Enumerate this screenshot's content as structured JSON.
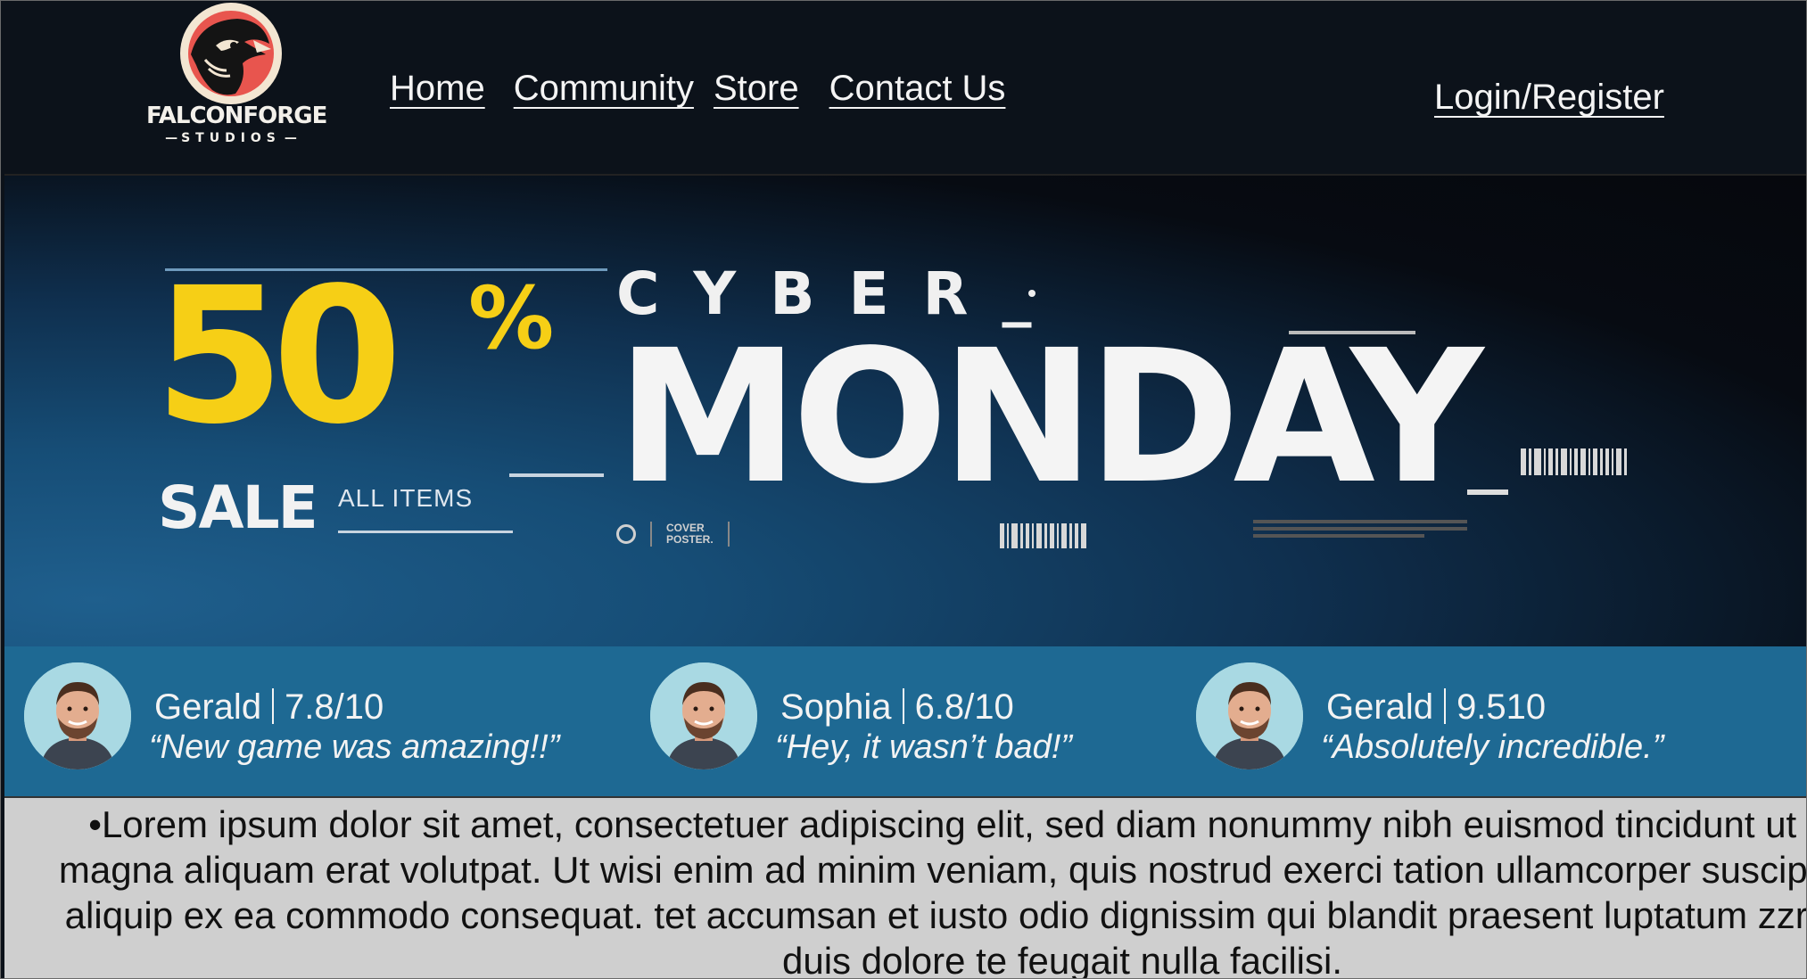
{
  "brand": {
    "name": "FALCONFORGE",
    "subtitle": "STUDIOS"
  },
  "nav": {
    "home": "Home",
    "community": "Community",
    "store": "Store",
    "contact": "Contact Us"
  },
  "auth": {
    "login": "Login/Register"
  },
  "hero": {
    "percent": "50",
    "percent_sign": "%",
    "sale": "SALE",
    "all_items": "ALL ITEMS",
    "cyber": "CYBER_",
    "monday": "MONDAY",
    "badge_line1": "COVER",
    "badge_line2": "POSTER."
  },
  "reviews": [
    {
      "name": "Gerald",
      "score": "7.8/10",
      "quote": "“New game was amazing!!”"
    },
    {
      "name": "Sophia",
      "score": "6.8/10",
      "quote": "“Hey, it wasn’t bad!”"
    },
    {
      "name": "Gerald",
      "score": "9.510",
      "quote": "“Absolutely incredible.”"
    }
  ],
  "body": {
    "bullet": "•",
    "text": "Lorem ipsum dolor sit amet, consectetuer adipiscing elit, sed diam nonummy nibh euismod tincidunt ut laoreet dolore magna aliquam erat volutpat. Ut wisi enim ad minim veniam, quis nostrud exerci tation ullamcorper suscipit lobortis nisl ut aliquip ex ea commodo consequat. tet accumsan et iusto odio dignissim qui blandit praesent luptatum zzril delenit augue duis dolore te feugait nulla facilisi."
  },
  "colors": {
    "header_bg": "#0c121a",
    "accent_yellow": "#f6cf16",
    "reviews_bg": "#1e6993",
    "body_bg": "#cfcfcf",
    "logo_red": "#e8554e"
  }
}
